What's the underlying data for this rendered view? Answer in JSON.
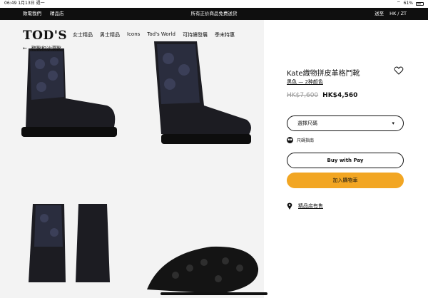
{
  "status": {
    "time": "06:49",
    "date": "1月13日 週一",
    "battery": "61%"
  },
  "promo": {
    "left": [
      "致電我們",
      "精品店"
    ],
    "center": "所有正价商品免费送货",
    "right": [
      "送至",
      "HK / ZT"
    ]
  },
  "header": {
    "logo": "TOD'S",
    "nav": [
      "女士精品",
      "男士精品",
      "Icons",
      "Tod's World",
      "可持續發展",
      "季末特惠"
    ],
    "breadcrumb": "鞋靴和沙漠靴"
  },
  "product": {
    "title": "Kate織物拼皮革格鬥靴",
    "color": "黑色 — 2种颜色",
    "old_price": "HK$7,600",
    "new_price": "HK$4,560",
    "size_select": "選擇尺碼",
    "size_guide": "尺碼指南",
    "apple_pay": "Buy with  Pay",
    "add_to_cart": "加入購物車",
    "store_stock": "精品店有售"
  },
  "colors": {
    "accent": "#f2a623",
    "promo_bg": "#0f0f0f",
    "gallery_bg": "#f3f3f3"
  }
}
